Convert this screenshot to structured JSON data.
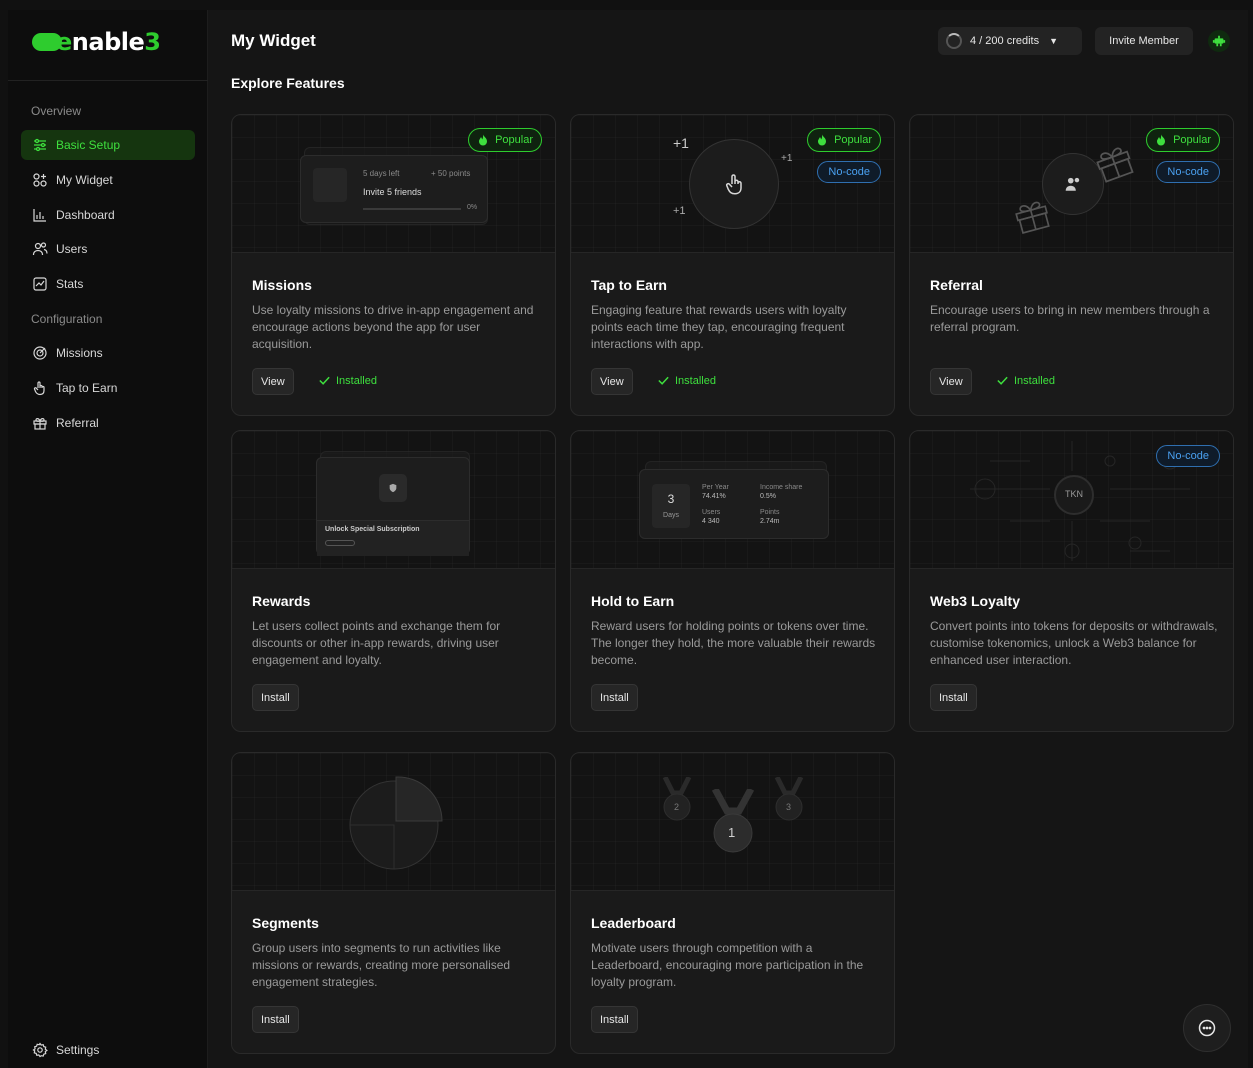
{
  "brand": {
    "logo_prefix": "",
    "logo_e": "e",
    "logo_rest": "nable",
    "logo_3": "3"
  },
  "sidebar": {
    "section_overview": "Overview",
    "section_configuration": "Configuration",
    "items": [
      {
        "label": "Basic Setup",
        "icon": "sliders-icon",
        "active": true
      },
      {
        "label": "My Widget",
        "icon": "widget-icon"
      },
      {
        "label": "Dashboard",
        "icon": "chart-icon"
      },
      {
        "label": "Users",
        "icon": "users-icon"
      },
      {
        "label": "Stats",
        "icon": "stats-icon"
      },
      {
        "label": "Missions",
        "icon": "target-icon"
      },
      {
        "label": "Tap to Earn",
        "icon": "tap-icon"
      },
      {
        "label": "Referral",
        "icon": "gift-icon"
      }
    ],
    "settings_label": "Settings"
  },
  "header": {
    "title": "My Widget",
    "credits_label": "4 / 200 credits",
    "invite_label": "Invite Member"
  },
  "main": {
    "section_title": "Explore Features",
    "badges": {
      "popular": "Popular",
      "nocode": "No-code"
    },
    "installed_label": "Installed",
    "cards": [
      {
        "title": "Missions",
        "desc": "Use loyalty missions to drive in-app engagement and encourage actions beyond the app for user acquisition.",
        "button": "View",
        "installed": true,
        "popular": true,
        "nocode": false
      },
      {
        "title": "Tap to Earn",
        "desc": "Engaging feature that rewards users with loyalty points each time they tap, encouraging frequent interactions with app.",
        "button": "View",
        "installed": true,
        "popular": true,
        "nocode": true
      },
      {
        "title": "Referral",
        "desc": "Encourage users to bring in new members through a referral program.",
        "button": "View",
        "installed": true,
        "popular": true,
        "nocode": true
      },
      {
        "title": "Rewards",
        "desc": "Let users collect points and exchange them for discounts or other in-app rewards, driving user engagement and loyalty.",
        "button": "Install",
        "installed": false,
        "popular": false,
        "nocode": false
      },
      {
        "title": "Hold to Earn",
        "desc": "Reward users for holding points or tokens over time. The longer they hold, the more valuable their rewards become.",
        "button": "Install",
        "installed": false,
        "popular": false,
        "nocode": false
      },
      {
        "title": "Web3 Loyalty",
        "desc": "Convert points into tokens for deposits or withdrawals, customise tokenomics, unlock a Web3 balance for enhanced user interaction.",
        "button": "Install",
        "installed": false,
        "popular": false,
        "nocode": true
      },
      {
        "title": "Segments",
        "desc": "Group users into segments to run activities like missions or rewards, creating more personalised engagement strategies.",
        "button": "Install",
        "installed": false,
        "popular": false,
        "nocode": false
      },
      {
        "title": "Leaderboard",
        "desc": "Motivate users through competition with a Leaderboard, encouraging more participation in the loyalty program.",
        "button": "Install",
        "installed": false,
        "popular": false,
        "nocode": false
      }
    ],
    "hero_text": {
      "missions_days": "5 days left",
      "missions_points": "+ 50 points",
      "missions_task": "Invite 5 friends",
      "missions_pct": "0%",
      "tap_plus1": "+1",
      "rewards_unlock": "Unlock Special Subscription",
      "hold_days_num": "3",
      "hold_days": "Days",
      "hold_per_year": "Per Year",
      "hold_per_year_val": "74.41%",
      "hold_income": "Income share",
      "hold_income_val": "0.5%",
      "hold_users": "Users",
      "hold_users_val": "4 340",
      "hold_points": "Points",
      "hold_points_val": "2.74m",
      "web3_token": "TKN",
      "lb_first": "1",
      "lb_second": "2",
      "lb_third": "3"
    }
  },
  "colors": {
    "accent": "#3ee03e",
    "nocode": "#4aa0f0",
    "bg": "#151515"
  }
}
